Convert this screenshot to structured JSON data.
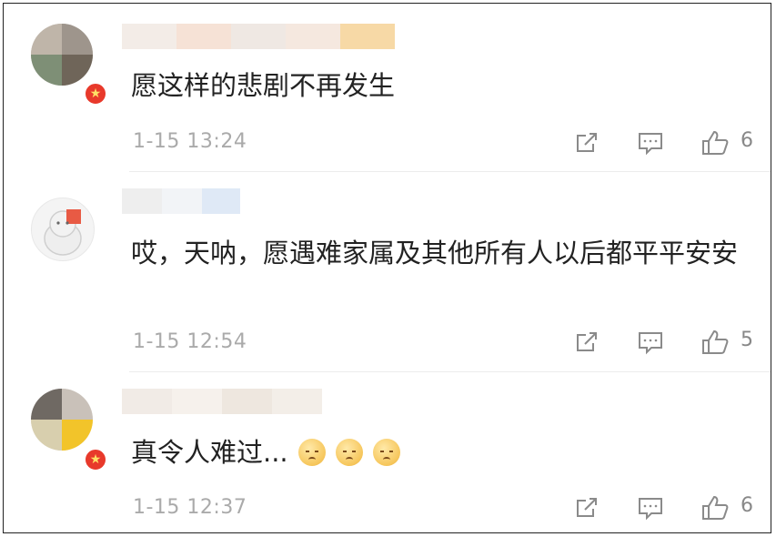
{
  "comments": [
    {
      "text": "愿这样的悲剧不再发生",
      "time": "1-15 13:24",
      "likes": "6"
    },
    {
      "text": "哎，天呐，愿遇难家属及其他所有人以后都平平安安",
      "time": "1-15 12:54",
      "likes": "5"
    },
    {
      "text": "真令人难过...",
      "time": "1-15 12:37",
      "likes": "6",
      "emoji": [
        "sad-face",
        "sad-face",
        "sad-face"
      ]
    }
  ],
  "icons": {
    "share": "share-icon",
    "reply": "reply-icon",
    "like": "thumbs-up-icon",
    "verified": "verified-badge"
  },
  "colors": {
    "text": "#222222",
    "meta": "#aaaaaa",
    "icon": "#8a8a8a",
    "badge": "#e8392b"
  }
}
